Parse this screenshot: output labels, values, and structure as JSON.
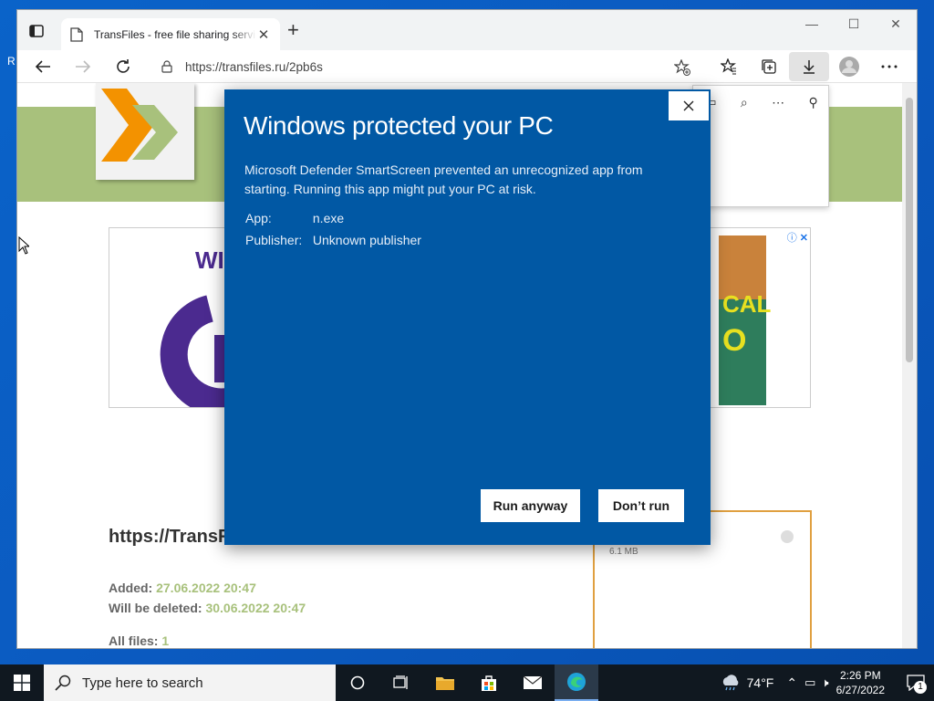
{
  "desktop": {
    "edge_letter": "R"
  },
  "browser": {
    "tab_title": "TransFiles - free file sharing service",
    "url": "https://transfiles.ru/2pb6s"
  },
  "page": {
    "heading": "https://TransF",
    "added_label": "Added:",
    "added_value": "27.06.2022 20:47",
    "deleted_label": "Will be deleted:",
    "deleted_value": "30.06.2022 20:47",
    "files_label": "All files:",
    "files_value": "1",
    "file_size": "6.1 MB"
  },
  "dialog": {
    "title": "Windows protected your PC",
    "message": "Microsoft Defender SmartScreen prevented an unrecognized app from starting. Running this app might put your PC at risk.",
    "app_label": "App:",
    "app_value": "n.exe",
    "publisher_label": "Publisher:",
    "publisher_value": "Unknown publisher",
    "run_anyway": "Run anyway",
    "dont_run": "Don’t run"
  },
  "taskbar": {
    "search_placeholder": "Type here to search",
    "temperature": "74°F",
    "time": "2:26 PM",
    "date": "6/27/2022",
    "notification_count": "1"
  },
  "colors": {
    "dialog_bg": "#0158a4",
    "banner_green": "#a8c17c",
    "taskbar_bg": "#101820"
  }
}
